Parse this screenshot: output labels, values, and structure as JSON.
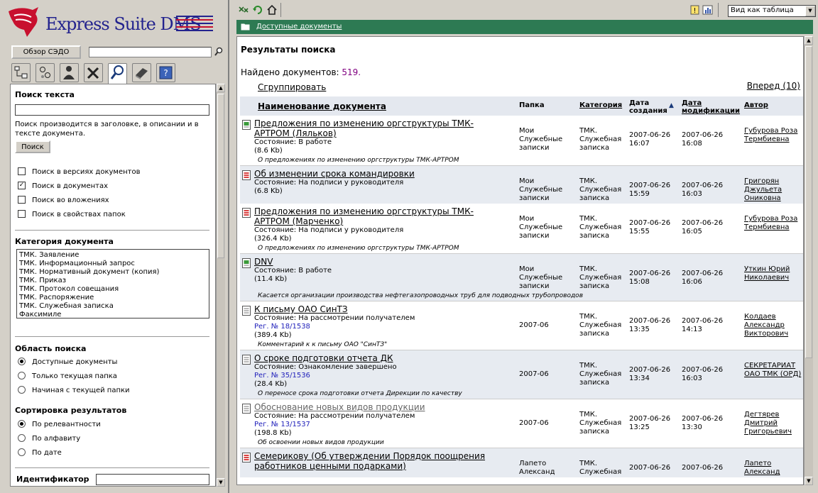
{
  "app": {
    "logo_text": "Express Suite DMS"
  },
  "left": {
    "browse_button": "Обзор СЭДО",
    "search_input_value": "",
    "text_search": {
      "title": "Поиск текста",
      "input_value": "",
      "hint": "Поиск производится в заголовке, в описании и в тексте документа.",
      "button": "Поиск",
      "options": [
        {
          "label": "Поиск в версиях документов",
          "checked": false
        },
        {
          "label": "Поиск в документах",
          "checked": true
        },
        {
          "label": "Поиск во вложениях",
          "checked": false
        },
        {
          "label": "Поиск в свойствах папок",
          "checked": false
        }
      ]
    },
    "category": {
      "title": "Категория документа",
      "items": [
        "ТМК. Заявление",
        "ТМК. Информационный запрос",
        "ТМК. Нормативный документ (копия)",
        "ТМК. Приказ",
        "ТМК. Протокол совещания",
        "ТМК. Распоряжение",
        "ТМК. Служебная записка",
        "Факсимиле"
      ]
    },
    "scope": {
      "title": "Область поиска",
      "options": [
        {
          "label": "Доступные документы",
          "selected": true
        },
        {
          "label": "Только текущая папка",
          "selected": false
        },
        {
          "label": "Начиная с текущей папки",
          "selected": false
        }
      ]
    },
    "sort": {
      "title": "Сортировка результатов",
      "options": [
        {
          "label": "По релевантности",
          "selected": true
        },
        {
          "label": "По алфавиту",
          "selected": false
        },
        {
          "label": "По дате",
          "selected": false
        }
      ]
    },
    "identifier": {
      "label": "Идентификатор",
      "value": ""
    }
  },
  "right": {
    "view_select": "Вид как таблица",
    "breadcrumb": "Доступные документы",
    "results_title": "Результаты поиска",
    "found_label": "Найдено документов:",
    "found_count": "519.",
    "group_link": "Сгруппировать",
    "next_link": "Вперед (10)",
    "columns": {
      "name": "Наименование документа",
      "folder": "Папка",
      "category": "Категория",
      "created": "Дата создания",
      "modified": "Дата модификации",
      "author": "Автор"
    },
    "rows": [
      {
        "title": "Предложения по изменению оргструктуры ТМК-АРТРОМ (Ляльков)",
        "state": "Состояние: В работе",
        "reg": "",
        "size": "(8.6 Kb)",
        "folder": "Мои Служебные записки",
        "category": "ТМК. Служебная записка",
        "created": "2007-06-26 16:07",
        "modified": "2007-06-26 16:08",
        "author": "Губурова Роза Термбиевна",
        "note": "О предложениях по изменению оргструктуры ТМК-АРТРОМ",
        "icon": "green",
        "visited": false
      },
      {
        "title": "Об изменении срока командировки",
        "state": "Состояние: На подписи у руководителя",
        "reg": "",
        "size": "(6.8 Kb)",
        "folder": "Мои Служебные записки",
        "category": "ТМК. Служебная записка",
        "created": "2007-06-26 15:59",
        "modified": "2007-06-26 16:03",
        "author": "Григорян Джульета Ониковна",
        "note": "",
        "icon": "red",
        "visited": false
      },
      {
        "title": "Предложения по изменению оргструктуры ТМК-АРТРОМ (Марченко)",
        "state": "Состояние: На подписи у руководителя",
        "reg": "",
        "size": "(326.4 Kb)",
        "folder": "Мои Служебные записки",
        "category": "ТМК. Служебная записка",
        "created": "2007-06-26 15:55",
        "modified": "2007-06-26 16:05",
        "author": "Губурова Роза Термбиевна",
        "note": "О предложениях по изменению оргструктуры ТМК-АРТРОМ",
        "icon": "red",
        "visited": false
      },
      {
        "title": "DNV",
        "state": "Состояние: В работе",
        "reg": "",
        "size": "(11.4 Kb)",
        "folder": "Мои Служебные записки",
        "category": "ТМК. Служебная записка",
        "created": "2007-06-26 15:08",
        "modified": "2007-06-26 16:06",
        "author": "Уткин Юрий Николаевич",
        "note": "Касается организации производства нефтегазопроводных труб для подводных трубопроводов",
        "icon": "green",
        "visited": false
      },
      {
        "title": "К письму ОАО СинТЗ",
        "state": "Состояние: На рассмотрении получателем",
        "reg": "Рег. № 18/1538",
        "size": "(389.4 Kb)",
        "folder": "2007-06",
        "category": "ТМК. Служебная записка",
        "created": "2007-06-26 13:35",
        "modified": "2007-06-26 14:13",
        "author": "Колдаев Александр Викторович",
        "note": "Комментарий к к письму ОАО \"СинТЗ\"",
        "icon": "gray",
        "visited": false
      },
      {
        "title": "О сроке подготовки отчета ДК",
        "state": "Состояние: Ознакомление завершено",
        "reg": "Рег. № 35/1536",
        "size": "(28.4 Kb)",
        "folder": "2007-06",
        "category": "ТМК. Служебная записка",
        "created": "2007-06-26 13:34",
        "modified": "2007-06-26 16:03",
        "author": "СЕКРЕТАРИАТ ОАО ТМК (ОРД)",
        "note": "О переносе срока подготовки отчета Дирекции по качеству",
        "icon": "gray",
        "visited": false
      },
      {
        "title": "Обоснование новых видов продукции",
        "state": "Состояние: На рассмотрении получателем",
        "reg": "Рег. № 13/1537",
        "size": "(198.8 Kb)",
        "folder": "2007-06",
        "category": "ТМК. Служебная записка",
        "created": "2007-06-26 13:25",
        "modified": "2007-06-26 13:30",
        "author": "Дегтярев Дмитрий Григорьевич",
        "note": "Об освоении новых видов продукции",
        "icon": "gray",
        "visited": true
      },
      {
        "title": "Семерикову (Об утверждении Порядок поощрения работников ценными подарками)",
        "state": "",
        "reg": "",
        "size": "",
        "folder": "Лапето Александ",
        "category": "ТМК. Служебная",
        "created": "2007-06-26",
        "modified": "2007-06-26",
        "author": "Лапето Александ",
        "note": "",
        "icon": "red",
        "visited": false
      }
    ]
  },
  "colors": {
    "header_green": "#2d7a53",
    "logo_blue": "#23238e",
    "row_shade": "#e7ebf1"
  }
}
